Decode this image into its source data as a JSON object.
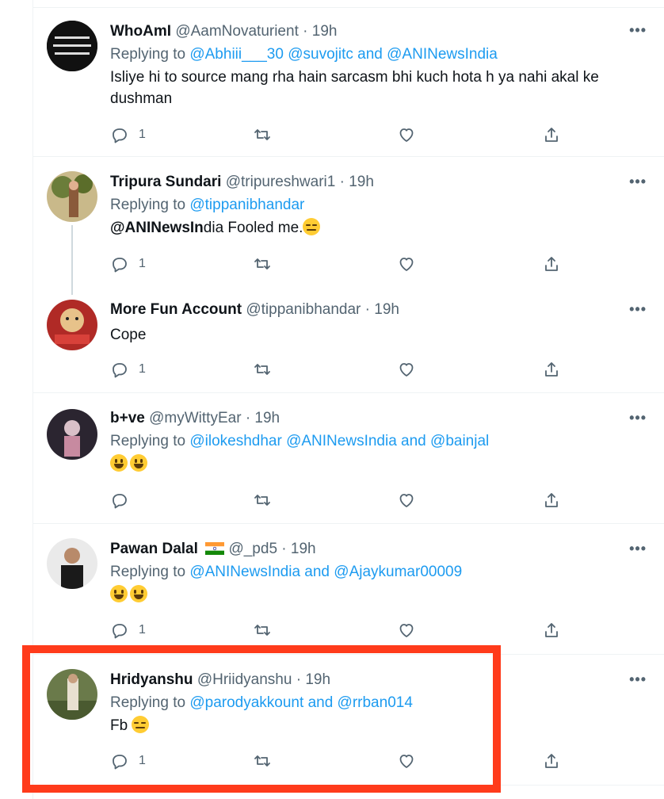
{
  "tweets": [
    {
      "name": "WhoAmI",
      "handle": "@AamNovaturient",
      "time": "19h",
      "replying_prefix": "Replying to",
      "replying_to": [
        "@Abhiii___30",
        "@suvojitc",
        "and",
        "@ANINewsIndia"
      ],
      "text": "Isliye hi to source mang rha hain sarcasm bhi kuch hota h ya nahi akal ke dushman",
      "reply_count": "1",
      "avatar_color": "#111111"
    },
    {
      "name": "Tripura Sundari",
      "handle": "@tripureshwari1",
      "time": "19h",
      "replying_prefix": "Replying to",
      "replying_to": [
        "@tippanibhandar"
      ],
      "text_bold": "@ANINewsIn",
      "text": "dia Fooled me.",
      "reply_count": "1",
      "avatar_color": "#7a6a3a"
    },
    {
      "name": "More Fun Account",
      "handle": "@tippanibhandar",
      "time": "19h",
      "text": "Cope",
      "reply_count": "1",
      "avatar_color": "#c9302c"
    },
    {
      "name": "b+ve",
      "handle": "@myWittyEar",
      "time": "19h",
      "replying_prefix": "Replying to",
      "replying_to": [
        "@ilokeshdhar",
        "@ANINewsIndia",
        "and",
        "@bainjal"
      ],
      "reply_count": "",
      "avatar_color": "#3b3340"
    },
    {
      "name": "Pawan Dalal",
      "handle": "@_pd5",
      "time": "19h",
      "replying_prefix": "Replying to",
      "replying_to": [
        "@ANINewsIndia",
        "and",
        "@Ajaykumar00009"
      ],
      "reply_count": "1",
      "avatar_color": "#e6e6e6"
    },
    {
      "name": "Hridyanshu",
      "handle": "@Hriidyanshu",
      "time": "19h",
      "replying_prefix": "Replying to",
      "replying_to": [
        "@parodyakkount",
        "and",
        "@rrban014"
      ],
      "text": "Fb",
      "reply_count": "1",
      "avatar_color": "#8a7a5a"
    }
  ],
  "ui": {
    "separator": "·",
    "more_label": "•••"
  },
  "icons": {
    "reply": "reply-icon",
    "retweet": "retweet-icon",
    "like": "heart-icon",
    "share": "share-icon"
  },
  "colors": {
    "link": "#1d9bf0",
    "muted": "#536471",
    "highlight": "#ff3b1b"
  }
}
